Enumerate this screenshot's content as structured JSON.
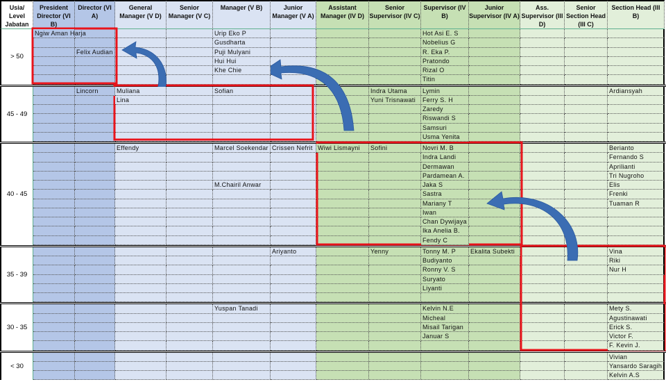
{
  "colors": {
    "group_top": "#b4c6e7",
    "group_mid": "#dae3f3",
    "group_green": "#c6e0b4",
    "group_lightgreen": "#e2efda",
    "highlight": "#e8141b",
    "arrow": "#3b6db3"
  },
  "header": {
    "age_label": "Usia/ Level Jabatan",
    "columns": [
      "President Director (VI B)",
      "Director (VI A)",
      "General Manager (V D)",
      "Senior Manager (V C)",
      "Manager (V B)",
      "Junior Manager (V A)",
      "Assistant Manager (IV D)",
      "Senior Supervisor (IV C)",
      "Supervisor (IV B)",
      "Junior Supervisor (IV A)",
      "Ass. Supervisor (III D)",
      "Senior Section Head (III C)",
      "Section Head (III B)"
    ]
  },
  "sections": [
    {
      "label": "> 50",
      "rows": [
        [
          "Ngiw Aman Harja",
          "",
          "",
          "",
          "Urip Eko P",
          "",
          "",
          "",
          "Hot Asi E. S",
          "",
          "",
          "",
          ""
        ],
        [
          "",
          "",
          "",
          "",
          "Gusdharta",
          "",
          "",
          "",
          "Nobelius G",
          "",
          "",
          "",
          ""
        ],
        [
          "",
          "Felix Audian",
          "",
          "",
          "Puji Mulyani",
          "",
          "",
          "",
          "R. Eka P.",
          "",
          "",
          "",
          ""
        ],
        [
          "",
          "",
          "",
          "",
          "Hui Hui",
          "",
          "",
          "",
          "Pratondo",
          "",
          "",
          "",
          ""
        ],
        [
          "",
          "",
          "",
          "",
          "Khe Chie",
          "",
          "",
          "",
          "Rizal O",
          "",
          "",
          "",
          ""
        ],
        [
          "",
          "",
          "",
          "",
          "",
          "",
          "",
          "",
          "Titin",
          "",
          "",
          "",
          ""
        ]
      ]
    },
    {
      "label": "45 - 49",
      "rows": [
        [
          "",
          "Lincorn",
          "Muliana",
          "",
          "Sofian",
          "",
          "",
          "Indra Utama",
          "Lymin",
          "",
          "",
          "",
          "Ardiansyah"
        ],
        [
          "",
          "",
          "Lina",
          "",
          "",
          "",
          "",
          "Yuni Trisnawati",
          "Ferry S. H",
          "",
          "",
          "",
          ""
        ],
        [
          "",
          "",
          "",
          "",
          "",
          "",
          "",
          "",
          "Zaredy",
          "",
          "",
          "",
          ""
        ],
        [
          "",
          "",
          "",
          "",
          "",
          "",
          "",
          "",
          "Riswandi S",
          "",
          "",
          "",
          ""
        ],
        [
          "",
          "",
          "",
          "",
          "",
          "",
          "",
          "",
          "Samsuri",
          "",
          "",
          "",
          ""
        ],
        [
          "",
          "",
          "",
          "",
          "",
          "",
          "",
          "",
          "Usma Yenita",
          "",
          "",
          "",
          ""
        ]
      ]
    },
    {
      "label": "40 - 45",
      "rows": [
        [
          "",
          "",
          "Effendy",
          "",
          "Marcel Soekendar",
          "Crissen Nefrit",
          "Wiwi Lismayni",
          "Sofini",
          "Novri M. B",
          "",
          "",
          "",
          "Berianto"
        ],
        [
          "",
          "",
          "",
          "",
          "",
          "",
          "",
          "",
          "Indra Landi",
          "",
          "",
          "",
          "Fernando S"
        ],
        [
          "",
          "",
          "",
          "",
          "",
          "",
          "",
          "",
          "Dermawan",
          "",
          "",
          "",
          "Aprilianti"
        ],
        [
          "",
          "",
          "",
          "",
          "",
          "",
          "",
          "",
          "Pardamean A.",
          "",
          "",
          "",
          "Tri Nugroho"
        ],
        [
          "",
          "",
          "",
          "",
          "M.Chairil Anwar",
          "",
          "",
          "",
          "Jaka S",
          "",
          "",
          "",
          "Elis"
        ],
        [
          "",
          "",
          "",
          "",
          "",
          "",
          "",
          "",
          "Sastra",
          "",
          "",
          "",
          "Frenki"
        ],
        [
          "",
          "",
          "",
          "",
          "",
          "",
          "",
          "",
          "Mariany T",
          "",
          "",
          "",
          "Tuaman R"
        ],
        [
          "",
          "",
          "",
          "",
          "",
          "",
          "",
          "",
          "Iwan",
          "",
          "",
          "",
          ""
        ],
        [
          "",
          "",
          "",
          "",
          "",
          "",
          "",
          "",
          "Chan Dywijaya",
          "",
          "",
          "",
          ""
        ],
        [
          "",
          "",
          "",
          "",
          "",
          "",
          "",
          "",
          "Ika Anelia B.",
          "",
          "",
          "",
          ""
        ],
        [
          "",
          "",
          "",
          "",
          "",
          "",
          "",
          "",
          "Fendy C",
          "",
          "",
          "",
          ""
        ]
      ]
    },
    {
      "label": "35 - 39",
      "rows": [
        [
          "",
          "",
          "",
          "",
          "",
          "Ariyanto",
          "",
          "Yenny",
          "Tonny M. P",
          "Ekalita Subekti",
          "",
          "",
          "Vina"
        ],
        [
          "",
          "",
          "",
          "",
          "",
          "",
          "",
          "",
          "Budiyanto",
          "",
          "",
          "",
          "Riki"
        ],
        [
          "",
          "",
          "",
          "",
          "",
          "",
          "",
          "",
          "Ronny V. S",
          "",
          "",
          "",
          "Nur H"
        ],
        [
          "",
          "",
          "",
          "",
          "",
          "",
          "",
          "",
          "Suryato",
          "",
          "",
          "",
          ""
        ],
        [
          "",
          "",
          "",
          "",
          "",
          "",
          "",
          "",
          "Liyanti",
          "",
          "",
          "",
          ""
        ],
        [
          "",
          "",
          "",
          "",
          "",
          "",
          "",
          "",
          "",
          "",
          "",
          "",
          ""
        ]
      ]
    },
    {
      "label": "30 - 35",
      "rows": [
        [
          "",
          "",
          "",
          "",
          "Yuspan Tanadi",
          "",
          "",
          "",
          "Kelvin N.E",
          "",
          "",
          "",
          "Mety S."
        ],
        [
          "",
          "",
          "",
          "",
          "",
          "",
          "",
          "",
          "Micheal",
          "",
          "",
          "",
          "Agustinawati"
        ],
        [
          "",
          "",
          "",
          "",
          "",
          "",
          "",
          "",
          "Misail Tarigan",
          "",
          "",
          "",
          "Erick S."
        ],
        [
          "",
          "",
          "",
          "",
          "",
          "",
          "",
          "",
          "Januar S",
          "",
          "",
          "",
          "Victor F."
        ],
        [
          "",
          "",
          "",
          "",
          "",
          "",
          "",
          "",
          "",
          "",
          "",
          "",
          "F. Kevin J."
        ]
      ]
    },
    {
      "label": "< 30",
      "rows": [
        [
          "",
          "",
          "",
          "",
          "",
          "",
          "",
          "",
          "",
          "",
          "",
          "",
          "Vivian"
        ],
        [
          "",
          "",
          "",
          "",
          "",
          "",
          "",
          "",
          "",
          "",
          "",
          "",
          "Yansardo Saragih"
        ],
        [
          "",
          "",
          "",
          "",
          "",
          "",
          "",
          "",
          "",
          "",
          "",
          "",
          "Kelvin A.S"
        ]
      ]
    }
  ]
}
